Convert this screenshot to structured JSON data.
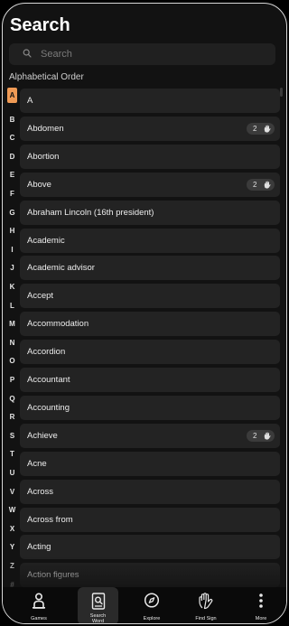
{
  "header": {
    "title": "Search"
  },
  "search": {
    "placeholder": "Search"
  },
  "section": {
    "label": "Alphabetical Order"
  },
  "alphabet": [
    "A",
    "B",
    "C",
    "D",
    "E",
    "F",
    "G",
    "H",
    "I",
    "J",
    "K",
    "L",
    "M",
    "N",
    "O",
    "P",
    "Q",
    "R",
    "S",
    "T",
    "U",
    "V",
    "W",
    "X",
    "Y",
    "Z",
    "#"
  ],
  "alphabet_active": "A",
  "words": [
    {
      "label": "A"
    },
    {
      "label": "Abdomen",
      "badge": "2"
    },
    {
      "label": "Abortion"
    },
    {
      "label": "Above",
      "badge": "2"
    },
    {
      "label": "Abraham Lincoln (16th president)"
    },
    {
      "label": "Academic"
    },
    {
      "label": "Academic advisor"
    },
    {
      "label": "Accept"
    },
    {
      "label": "Accommodation"
    },
    {
      "label": "Accordion"
    },
    {
      "label": "Accountant"
    },
    {
      "label": "Accounting"
    },
    {
      "label": "Achieve",
      "badge": "2"
    },
    {
      "label": "Acne"
    },
    {
      "label": "Across"
    },
    {
      "label": "Across from"
    },
    {
      "label": "Acting"
    },
    {
      "label": "Action figures"
    }
  ],
  "nav": [
    {
      "label": "Games",
      "icon": "games-icon"
    },
    {
      "label": "Search Word",
      "icon": "search-word-icon",
      "active": true
    },
    {
      "label": "Explore",
      "icon": "compass-icon"
    },
    {
      "label": "Find Sign",
      "icon": "hand-sign-icon"
    },
    {
      "label": "More",
      "icon": "more-icon"
    }
  ],
  "colors": {
    "accent": "#ef9a55",
    "background": "#121212",
    "row": "#232323"
  }
}
